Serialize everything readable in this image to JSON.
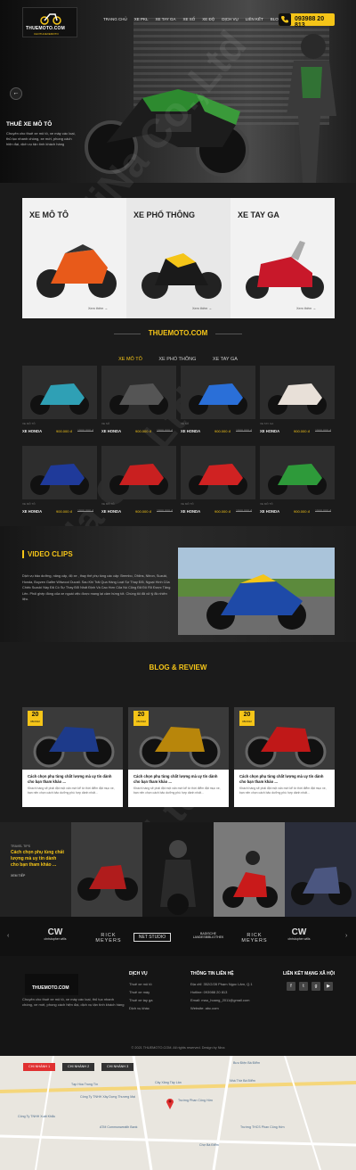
{
  "header": {
    "logo_text": "THUEMOTO.COM",
    "logo_sub": "CHOTHUEXEMOTO",
    "nav": [
      "TRANG CHỦ",
      "XE PKL",
      "XE TAY GA",
      "XE SỐ",
      "XE ĐỘ",
      "DỊCH VỤ",
      "LIÊN KẾT",
      "BLOG",
      "LIÊN HỆ"
    ],
    "hotline": "093988 20 813",
    "prev_arrow": "←"
  },
  "hero": {
    "title": "THUÊ XE MÔ TÔ",
    "desc": "Chuyên cho thuê xe mô tô, xe máy các loại, thủ tục nhanh chóng, xe mới, phong cách hiện đại, dịch vụ tận tình khách hàng"
  },
  "categories": [
    {
      "title": "XE MÔ TÔ",
      "more": "Xem thêm →"
    },
    {
      "title": "XE PHỔ THÔNG",
      "more": "Xem thêm →"
    },
    {
      "title": "XE TAY GA",
      "more": "Xem thêm →"
    }
  ],
  "brand_title": "THUEMOTO.COM",
  "tabs": [
    "XE MÔ TÔ",
    "XE PHỔ THÔNG",
    "XE TAY GA"
  ],
  "products": [
    {
      "cat": "XE MÔ TÔ",
      "name": "XE HONDA",
      "price": "900.000 đ",
      "old": "1500.000 đ",
      "color": "#2fa0b5"
    },
    {
      "cat": "XE SỐ",
      "name": "XE HONDA",
      "price": "900.000 đ",
      "old": "1500.000 đ",
      "color": "#555"
    },
    {
      "cat": "XE SỐ",
      "name": "XE HONDA",
      "price": "900.000 đ",
      "old": "1500.000 đ",
      "color": "#2a6fd8"
    },
    {
      "cat": "XE TAY GA",
      "name": "XE HONDA",
      "price": "900.000 đ",
      "old": "1500.000 đ",
      "color": "#e8e0d8"
    },
    {
      "cat": "XE MÔ TÔ",
      "name": "XE HONDA",
      "price": "900.000 đ",
      "old": "1500.000 đ",
      "color": "#1f3a9a"
    },
    {
      "cat": "XE MÔ TÔ",
      "name": "XE HONDA",
      "price": "900.000 đ",
      "old": "1500.000 đ",
      "color": "#c92020"
    },
    {
      "cat": "XE MÔ TÔ",
      "name": "XE HONDA",
      "price": "900.000 đ",
      "old": "1500.000 đ",
      "color": "#d02222"
    },
    {
      "cat": "XE MÔ TÔ",
      "name": "XE HONDA",
      "price": "900.000 đ",
      "old": "1500.000 đ",
      "color": "#2e9a3a"
    }
  ],
  "video": {
    "title": "VIDEO CLIPS",
    "text": "Dịch vụ bảo dưỡng, nâng cấp, độ xe , thay thế phụ tùng các cấp: Brembo, Ohlins, Nitron, Suzuki, Honda, Boyzen Galfer Wilwood Ducati. Sau Khi Trải Qua Hàng Loạt Sự Thay Đổi, Ngoại Hình Của Chiếc Suzuki Này Đã Có Sự Thay Đổi Nhất Định Và Cao Hơn Của Nó Cũng Đã Đủ Rõ Được Tăng Lên. Phối ghép đồng của xe ngoài việc được mang lại cảm hứng tốt. Chúng tôi đã xử lý 8k nhiên liệu."
  },
  "blog": {
    "title": "BLOG & REVIEW",
    "posts": [
      {
        "day": "20",
        "month": "08/2022",
        "title": "Cách chọn phụ tùng chất lượng mà uy tín dành cho bạn tham khảo ...",
        "desc": "Khách hàng sẽ phải đặt một vấn mới kể từ thời điểm đặt mục xe, bạn nên chọn cách bảo dưỡng phù hợp dành nhất..."
      },
      {
        "day": "20",
        "month": "08/2022",
        "title": "Cách chọn phụ tùng chất lượng mà uy tín dành cho bạn tham khảo ...",
        "desc": "Khách hàng sẽ phải đặt một vấn mới kể từ thời điểm đặt mục xe, bạn nên chọn cách bảo dưỡng phù hợp dành nhất..."
      },
      {
        "day": "20",
        "month": "08/2022",
        "title": "Cách chọn phụ tùng chất lượng mà uy tín dành cho bạn tham khảo ...",
        "desc": "Khách hàng sẽ phải đặt một vấn mới kể từ thời điểm đặt mục xe, bạn nên chọn cách bảo dưỡng phù hợp dành nhất..."
      }
    ]
  },
  "gallery": {
    "label": "TRAVEL TIPS",
    "title": "Cách chọn phụ tùng chất lượng mà uy tín dành cho bạn tham khảo ...",
    "more": "XEM TIẾP"
  },
  "partners": [
    "christopher wills",
    "RICK MEYERS",
    "NET STUDIO",
    "BADISCHE LANDESBIBLIOTHEK",
    "RICK MEYERS",
    "christopher wills"
  ],
  "footer": {
    "logo_text": "THUEMOTO.COM",
    "about": "Chuyên cho thuê xe mô tô, xe máy các loại, thủ tục nhanh chóng, xe mới, phong cách hiện đại, dịch vụ tận tình khách hàng",
    "col1_title": "DỊCH VỤ",
    "col1_items": [
      "Thuê xe mô tô",
      "Thuê xe máy",
      "Thuê xe tay ga",
      "Dịch vụ khác"
    ],
    "col2_title": "THÔNG TIN LIÊN HỆ",
    "col2_items": [
      "Địa chỉ: 352/2/28 Phạm Ngọc Lâm, Q.1",
      "Hotline: 093988 20 813",
      "Email: mau_hoang_2011@gmail.com",
      "Website: abc.com"
    ],
    "col3_title": "LIÊN KẾT MẠNG XÃ HỘI",
    "social": [
      "f",
      "t",
      "g",
      "▶"
    ],
    "copyright": "© 2021 THUEMOTO.COM. All rights reserved. Design by Nina"
  },
  "map": {
    "tabs": [
      "CHI NHÁNH 1",
      "CHI NHÁNH 2",
      "CHI NHÁNH 3"
    ],
    "labels": [
      "Tạp Hóa Trung Tín",
      "Công Ty TNHH Xây Dựng Thương Mại",
      "Công Ty TNHH Xuất Khẩu",
      "Bưu Điện Bà Điểm",
      "Trường Phan Công Hớn",
      "ATM Commonwealth Bank",
      "Chợ Bà Điểm",
      "Nhà Thờ Bà Điểm",
      "Cây Xăng Tây Lân",
      "Trường THCS Phan Công Hớn"
    ]
  }
}
